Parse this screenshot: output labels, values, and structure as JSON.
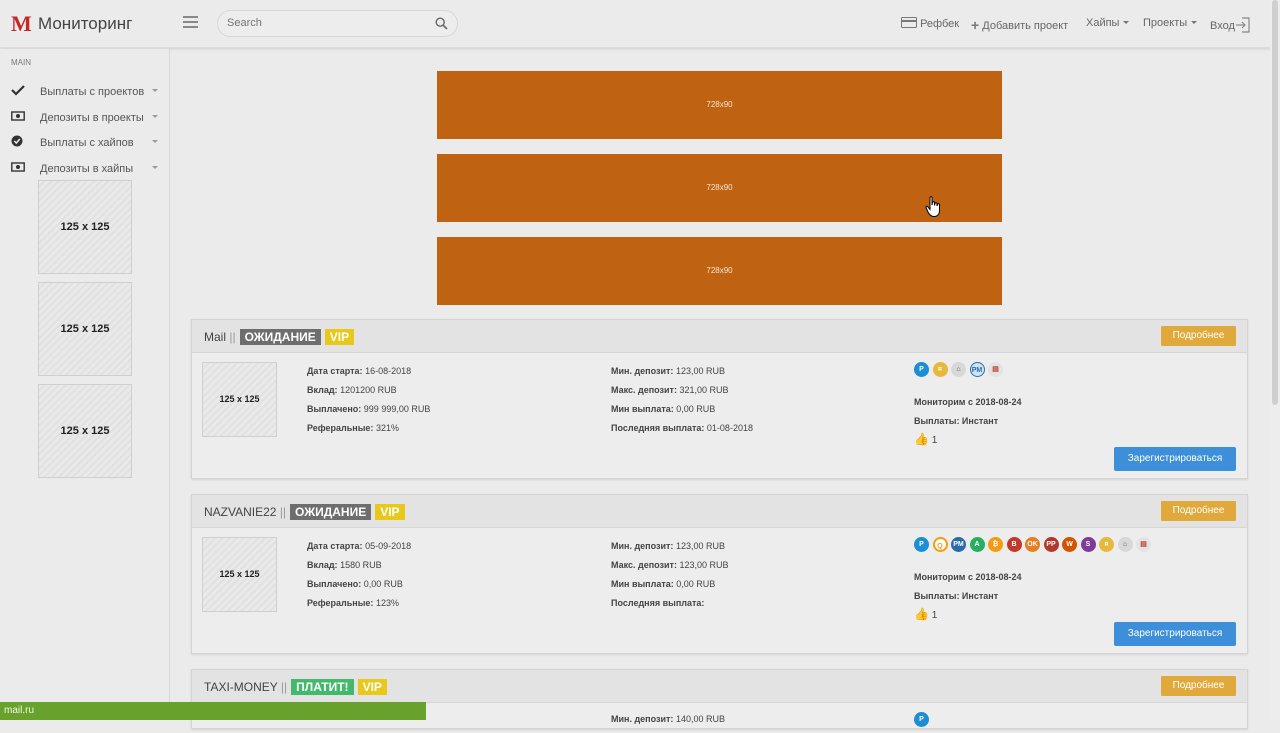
{
  "header": {
    "logo_letter": "M",
    "title": "Мониторинг",
    "search_placeholder": "Search",
    "nav": {
      "refback": "Рефбек",
      "add_project": "Добавить проект",
      "hyips": "Хайпы",
      "projects": "Проекты",
      "login": "Вход"
    }
  },
  "sidebar": {
    "section": "MAIN",
    "items": [
      {
        "label": "Выплаты с проектов",
        "icon": "check-icon"
      },
      {
        "label": "Депозиты в проекты",
        "icon": "money-icon"
      },
      {
        "label": "Выплаты с хайпов",
        "icon": "check-circle-icon"
      },
      {
        "label": "Депозиты в хайпы",
        "icon": "money-icon"
      }
    ],
    "ads": [
      "125 x 125",
      "125 x 125",
      "125 x 125"
    ]
  },
  "banners": [
    "728x90",
    "728x90",
    "728x90"
  ],
  "projects": [
    {
      "name": "Mail",
      "separator": "||",
      "status": "ОЖИДАНИЕ",
      "vip": "VIP",
      "more": "Подробнее",
      "thumb": "125 x 125",
      "start_label": "Дата старта:",
      "start": "16-08-2018",
      "deposit_label": "Вклад:",
      "deposit": "1201200 RUB",
      "paid_label": "Выплачено:",
      "paid": "999 999,00 RUB",
      "ref_label": "Реферальные:",
      "ref": "321%",
      "min_dep_label": "Мин. депозит:",
      "min_dep": "123,00 RUB",
      "max_dep_label": "Макс. депозит:",
      "max_dep": "321,00 RUB",
      "min_pay_label": "Мин выплата:",
      "min_pay": "0,00 RUB",
      "last_pay_label": "Последняя выплата:",
      "last_pay": "01-08-2018",
      "monitor": "Мониторим с 2018-08-24",
      "payouts": "Выплаты: Инстант",
      "likes": "1",
      "register": "Зарегистрироваться",
      "pay_systems": [
        "payeer",
        "coin",
        "bank",
        "perfect-money",
        "card"
      ]
    },
    {
      "name": "NAZVANIE22",
      "separator": "||",
      "status": "ОЖИДАНИЕ",
      "vip": "VIP",
      "more": "Подробнее",
      "thumb": "125 x 125",
      "start_label": "Дата старта:",
      "start": "05-09-2018",
      "deposit_label": "Вклад:",
      "deposit": "1580 RUB",
      "paid_label": "Выплачено:",
      "paid": "0,00 RUB",
      "ref_label": "Реферальные:",
      "ref": "123%",
      "min_dep_label": "Мин. депозит:",
      "min_dep": "123,00 RUB",
      "max_dep_label": "Макс. депозит:",
      "max_dep": "123,00 RUB",
      "min_pay_label": "Мин выплата:",
      "min_pay": "0,00 RUB",
      "last_pay_label": "Последняя выплата:",
      "last_pay": "",
      "monitor": "Мониторим с 2018-08-24",
      "payouts": "Выплаты: Инстант",
      "likes": "1",
      "register": "Зарегистрироваться",
      "pay_systems": [
        "payeer",
        "qiwi",
        "perfect-money",
        "advcash",
        "bitcoin",
        "bitcoin-cash",
        "ok-pay",
        "paypal",
        "wmr",
        "bank",
        "skrill",
        "coin",
        "bank",
        "card"
      ]
    },
    {
      "name": "TAXI-MONEY",
      "separator": "||",
      "status": "ПЛАТИТ!",
      "vip": "VIP",
      "more": "Подробнее",
      "min_dep_label": "Мин. депозит:",
      "min_dep": "140,00 RUB"
    }
  ],
  "statusbar": "mail.ru",
  "colors": {
    "accent_orange": "#bf6211",
    "button_blue": "#3d8fd9",
    "more_button": "#e0a93b",
    "vip_yellow": "#e8c81b",
    "pay_green": "#43b96c",
    "status_green": "#68a22c"
  }
}
